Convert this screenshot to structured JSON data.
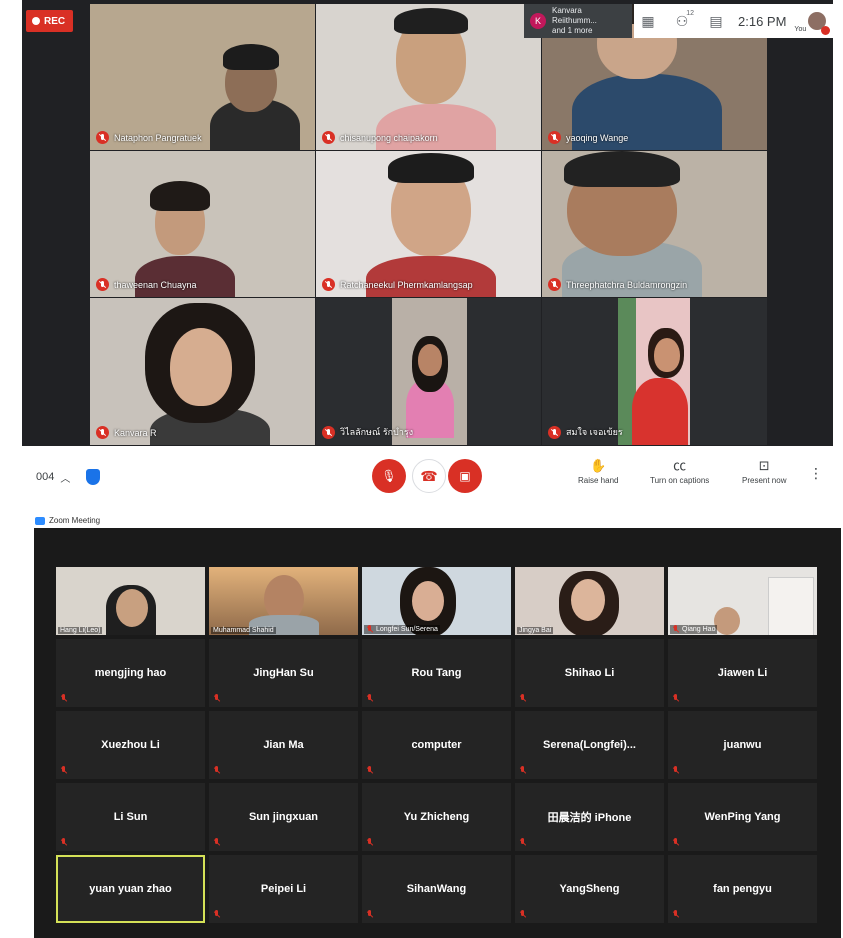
{
  "meet": {
    "rec_label": "REC",
    "presenter": {
      "initial": "K",
      "line1": "Kanvara Reiithumm...",
      "line2": "and 1 more"
    },
    "participant_count": "12",
    "clock": "2:16 PM",
    "you_label": "You",
    "tiles": [
      {
        "name": "Nataphon Pangratuek",
        "bg": "#b7a78f"
      },
      {
        "name": "chisanupong chaipakorn",
        "bg": "#d8d4cf"
      },
      {
        "name": "yaoqing Wange",
        "bg": "#8a7868"
      },
      {
        "name": "thaweenan Chuayna",
        "bg": "#c9c3ba"
      },
      {
        "name": "Ratchaneekul Phermkamlangsap",
        "bg": "#e4e0de"
      },
      {
        "name": "Threephatchra Buldamrongzin",
        "bg": "#bbb2a6"
      },
      {
        "name": "Kanvara R",
        "bg": "#c8c2bb"
      },
      {
        "name": "วิไลลักษณ์ รักบำรุง",
        "bg": "#2b2d30"
      },
      {
        "name": "สมใจ เจอเข้ยร",
        "bg": "#2b2d30"
      }
    ],
    "meeting_code": "004",
    "raise_hand": "Raise hand",
    "captions": "Turn on captions",
    "present_now": "Present now"
  },
  "zoom": {
    "window_title": "Zoom Meeting",
    "video_tiles": [
      {
        "name": "Hang Li(Leo)",
        "bg": "#d9d4cc"
      },
      {
        "name": "Muhammad Shahid",
        "bg": "#c58a4a"
      },
      {
        "name": "Longfei Sun/Serena",
        "bg": "#cfd8df"
      },
      {
        "name": "Jingya Bai",
        "bg": "#d7cdc6"
      },
      {
        "name": "Qiang Hao",
        "bg": "#e6e4e1"
      }
    ],
    "name_tiles": [
      "mengjing hao",
      "JingHan Su",
      "Rou Tang",
      "Shihao Li",
      "Jiawen Li",
      "Xuezhou Li",
      "Jian Ma",
      "computer",
      "Serena(Longfei)...",
      "juanwu",
      "Li Sun",
      "Sun jingxuan",
      "Yu Zhicheng",
      "田晨洁的 iPhone",
      "WenPing Yang",
      "yuan yuan zhao",
      "Peipei Li",
      "SihanWang",
      "YangSheng",
      "fan pengyu"
    ]
  },
  "colors": {
    "meet_bg": "#202124",
    "mute_red": "#d93025",
    "zoom_bg": "#1a1a1a",
    "zoom_tile": "#242424",
    "active_speaker": "#d4e157"
  }
}
